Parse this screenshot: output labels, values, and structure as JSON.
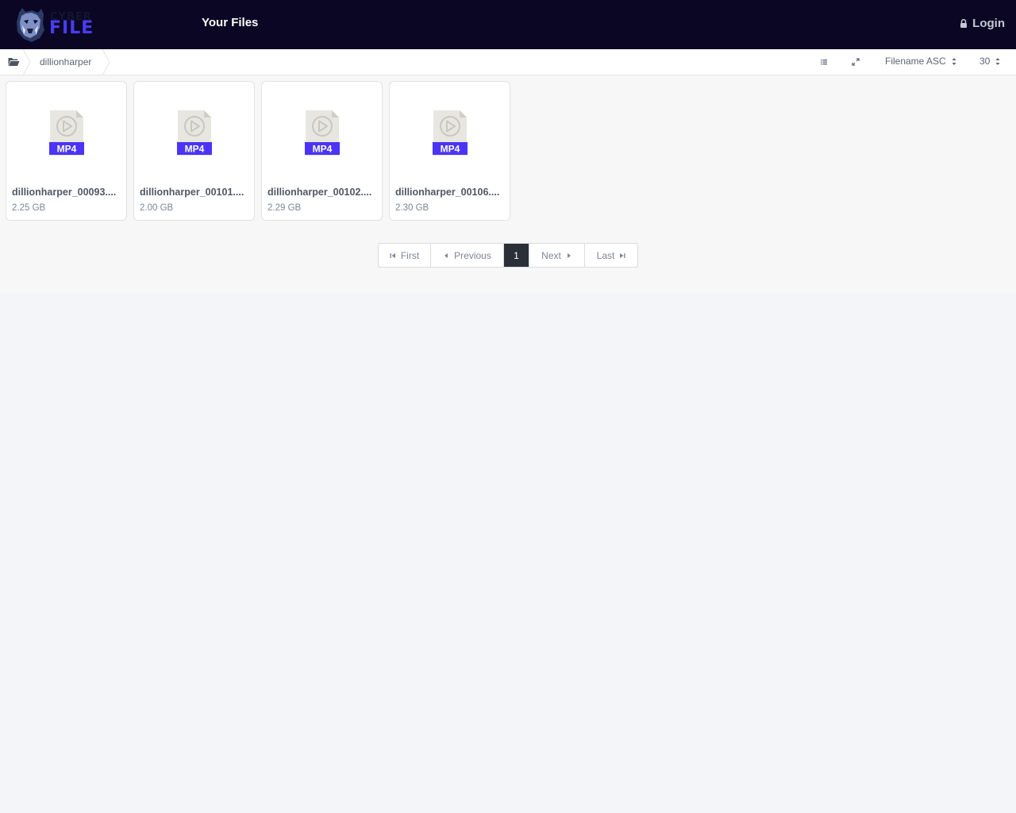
{
  "header": {
    "logo_top": "CYBER",
    "logo_bottom": "FILE",
    "title": "Your Files",
    "login_label": "Login",
    "login_icon": "lock-icon"
  },
  "toolbar": {
    "root_icon": "folder-open-icon",
    "breadcrumb": [
      "dillionharper"
    ],
    "list_view_icon": "list-icon",
    "fullscreen_icon": "expand-icon",
    "sort_label": "Filename ASC",
    "per_page": "30"
  },
  "files": [
    {
      "name": "dillionharper_00093.mp4",
      "display_name": "dillionharper_00093....",
      "size": "2.25 GB",
      "type": "MP4"
    },
    {
      "name": "dillionharper_00101.mp4",
      "display_name": "dillionharper_00101....",
      "size": "2.00 GB",
      "type": "MP4"
    },
    {
      "name": "dillionharper_00102.mp4",
      "display_name": "dillionharper_00102....",
      "size": "2.29 GB",
      "type": "MP4"
    },
    {
      "name": "dillionharper_00106.mp4",
      "display_name": "dillionharper_00106....",
      "size": "2.30 GB",
      "type": "MP4"
    }
  ],
  "pagination": {
    "first": "First",
    "previous": "Previous",
    "current": "1",
    "next": "Next",
    "last": "Last"
  },
  "colors": {
    "header_bg": "#0a0624",
    "brand_purple": "#4a3cf2",
    "file_badge": "#4b34f5"
  }
}
